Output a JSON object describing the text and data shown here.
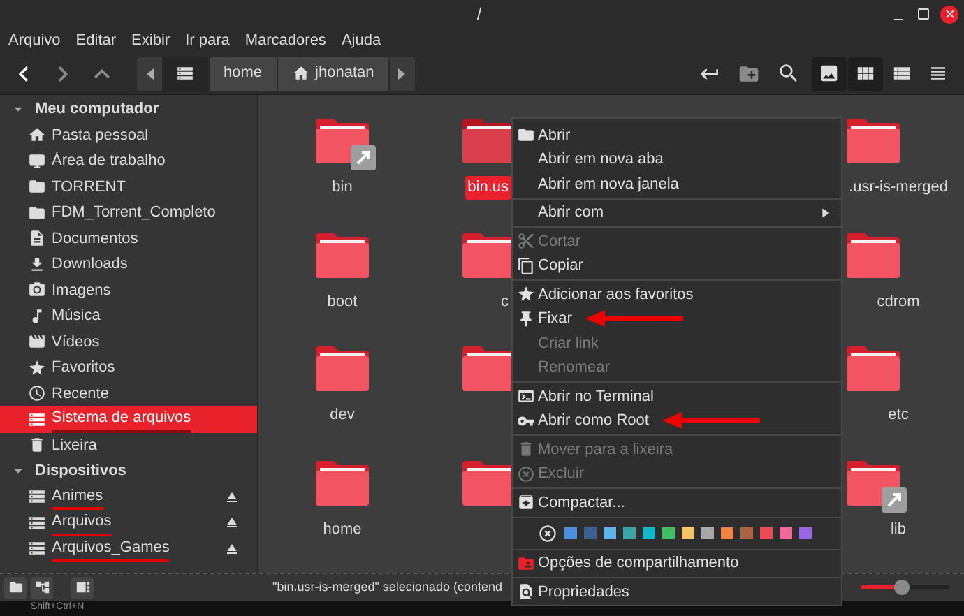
{
  "window": {
    "title": "/"
  },
  "menubar": [
    "Arquivo",
    "Editar",
    "Exibir",
    "Ir para",
    "Marcadores",
    "Ajuda"
  ],
  "toolbar": {
    "back_enabled": true,
    "forward_enabled": false,
    "up_enabled": false,
    "breadcrumb": [
      {
        "selected": true
      },
      {
        "label": "home",
        "selected": false
      },
      {
        "label": "jhonatan",
        "selected": false
      }
    ],
    "views": [
      {
        "selected": true
      },
      {
        "selected": true
      },
      {
        "selected": false
      },
      {
        "selected": false
      }
    ]
  },
  "sidebar": {
    "sections": [
      {
        "title": "Meu computador",
        "expanded": true,
        "items": [
          {
            "label": "Pasta pessoal",
            "selected": false
          },
          {
            "label": "Área de trabalho",
            "selected": false
          },
          {
            "label": "TORRENT",
            "selected": false
          },
          {
            "label": "FDM_Torrent_Completo",
            "selected": false
          },
          {
            "label": "Documentos",
            "selected": false
          },
          {
            "label": "Downloads",
            "selected": false
          },
          {
            "label": "Imagens",
            "selected": false
          },
          {
            "label": "Música",
            "selected": false
          },
          {
            "label": "Vídeos",
            "selected": false
          },
          {
            "label": "Favoritos",
            "selected": false
          },
          {
            "label": "Recente",
            "selected": false
          },
          {
            "label": "Sistema de arquivos",
            "selected": true,
            "underlined": true
          },
          {
            "label": "Lixeira",
            "selected": false
          }
        ]
      },
      {
        "title": "Dispositivos",
        "expanded": true,
        "items": [
          {
            "label": "Animes",
            "selected": false,
            "underlined": true,
            "eject": true
          },
          {
            "label": "Arquivos",
            "selected": false,
            "underlined": true,
            "eject": true
          },
          {
            "label": "Arquivos_Games",
            "selected": false,
            "underlined": true,
            "eject": true
          }
        ]
      }
    ]
  },
  "files": [
    {
      "label": "bin",
      "selected": false,
      "link": true
    },
    {
      "label": "bin.us",
      "selected": true
    },
    {
      "label": ".usr-is-merged",
      "selected": false
    },
    {
      "label": "boot",
      "selected": false
    },
    {
      "label": "c",
      "selected": false
    },
    {
      "label": "cdrom",
      "selected": false
    },
    {
      "label": "dev",
      "selected": false
    },
    {
      "selected": false
    },
    {
      "label": "etc",
      "selected": false
    },
    {
      "label": "home",
      "selected": false
    },
    {
      "selected": false
    },
    {
      "label": "lib",
      "selected": false,
      "link": true
    }
  ],
  "status_bar": {
    "text": "\"bin.usr-is-merged\" selecionado (contend",
    "zoom": {
      "level": 0.45
    }
  },
  "tooltip": "Shift+Ctrl+N",
  "context_menu": {
    "sections": [
      {
        "kind": "items",
        "items": [
          {
            "label": "Abrir",
            "disabled": false
          },
          {
            "label": "Abrir em nova aba",
            "disabled": false
          },
          {
            "label": "Abrir em nova janela",
            "disabled": false
          }
        ]
      },
      {
        "kind": "items",
        "items": [
          {
            "label": "Abrir com",
            "disabled": false,
            "submenu": true
          }
        ]
      },
      {
        "kind": "items",
        "items": [
          {
            "label": "Cortar",
            "disabled": true
          },
          {
            "label": "Copiar",
            "disabled": false
          }
        ]
      },
      {
        "kind": "items",
        "items": [
          {
            "label": "Adicionar aos favoritos",
            "disabled": false
          },
          {
            "label": "Fixar",
            "disabled": false,
            "annotated": true
          },
          {
            "label": "Criar link",
            "disabled": true
          },
          {
            "label": "Renomear",
            "disabled": true
          }
        ]
      },
      {
        "kind": "items",
        "items": [
          {
            "label": "Abrir no Terminal",
            "disabled": false
          },
          {
            "label": "Abrir como Root",
            "disabled": false,
            "annotated": true
          }
        ]
      },
      {
        "kind": "items",
        "items": [
          {
            "label": "Mover para a lixeira",
            "disabled": true
          },
          {
            "label": "Excluir",
            "disabled": true
          }
        ]
      },
      {
        "kind": "items",
        "items": [
          {
            "label": "Compactar...",
            "disabled": false
          }
        ]
      },
      {
        "kind": "swatches",
        "swatches": [
          {
            "color": "#4a8fe0"
          },
          {
            "color": "#3d5f94"
          },
          {
            "color": "#5db3ec"
          },
          {
            "color": "#3aa5a8"
          },
          {
            "color": "#10b9cc"
          },
          {
            "color": "#3fbf63"
          },
          {
            "color": "#f3c46a"
          },
          {
            "color": "#a8a8a8"
          },
          {
            "color": "#f28448"
          },
          {
            "color": "#a8653f"
          },
          {
            "color": "#ea4b55"
          },
          {
            "color": "#f0679a"
          },
          {
            "color": "#9a66e6"
          }
        ]
      },
      {
        "kind": "items",
        "items": [
          {
            "label": "Opções de compartilhamento",
            "disabled": false
          }
        ]
      },
      {
        "kind": "items",
        "items": [
          {
            "label": "Propriedades",
            "disabled": false
          }
        ]
      }
    ]
  }
}
